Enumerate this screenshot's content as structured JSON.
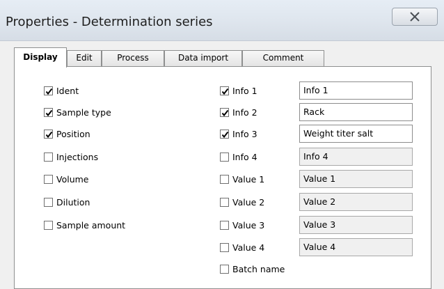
{
  "window": {
    "title": "Properties - Determination series"
  },
  "tabs": [
    {
      "label": "Display",
      "active": true
    },
    {
      "label": "Edit",
      "active": false
    },
    {
      "label": "Process",
      "active": false
    },
    {
      "label": "Data import",
      "active": false
    },
    {
      "label": "Comment",
      "active": false
    }
  ],
  "display": {
    "left_options": [
      {
        "label": "Ident",
        "checked": true
      },
      {
        "label": "Sample type",
        "checked": true
      },
      {
        "label": "Position",
        "checked": true
      },
      {
        "label": "Injections",
        "checked": false
      },
      {
        "label": "Volume",
        "checked": false
      },
      {
        "label": "Dilution",
        "checked": false
      },
      {
        "label": "Sample amount",
        "checked": false
      }
    ],
    "right_options": [
      {
        "label": "Info 1",
        "checked": true,
        "field": "Info 1"
      },
      {
        "label": "Info 2",
        "checked": true,
        "field": "Rack"
      },
      {
        "label": "Info 3",
        "checked": true,
        "field": "Weight titer salt"
      },
      {
        "label": "Info 4",
        "checked": false,
        "field": "Info 4"
      },
      {
        "label": "Value 1",
        "checked": false,
        "field": "Value 1"
      },
      {
        "label": "Value 2",
        "checked": false,
        "field": "Value 2"
      },
      {
        "label": "Value 3",
        "checked": false,
        "field": "Value 3"
      },
      {
        "label": "Value 4",
        "checked": false,
        "field": "Value 4"
      },
      {
        "label": "Batch name",
        "checked": false
      }
    ]
  }
}
